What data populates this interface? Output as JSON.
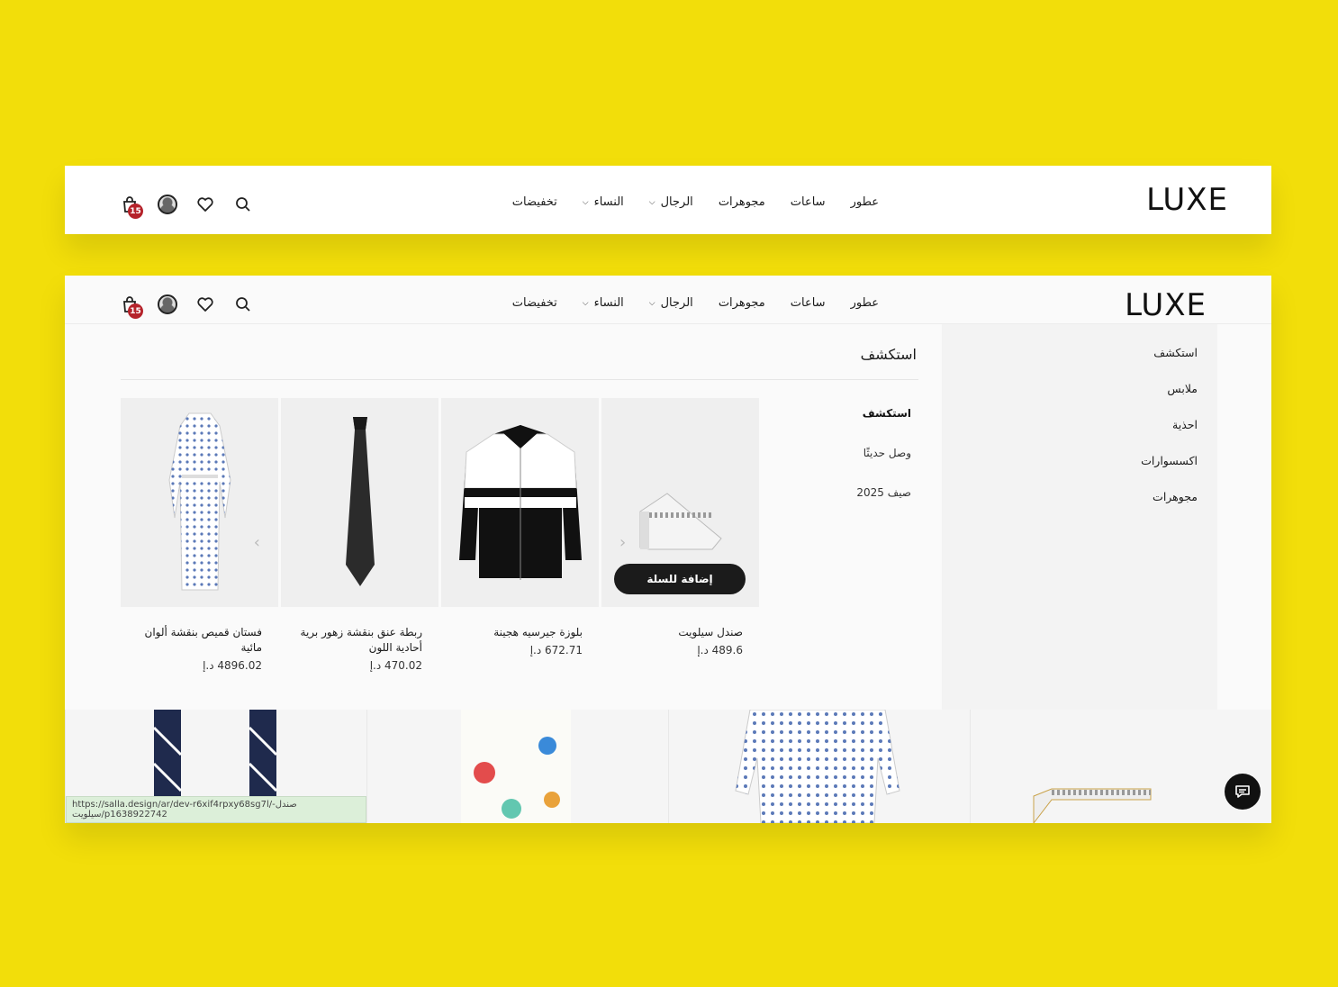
{
  "brand": {
    "logo": "LUXE"
  },
  "nav": [
    {
      "label": "تخفيضات",
      "has_dropdown": false
    },
    {
      "label": "النساء",
      "has_dropdown": true
    },
    {
      "label": "الرجال",
      "has_dropdown": true
    },
    {
      "label": "مجوهرات",
      "has_dropdown": false
    },
    {
      "label": "ساعات",
      "has_dropdown": false
    },
    {
      "label": "عطور",
      "has_dropdown": false
    }
  ],
  "header_icons": {
    "cart_count": "15",
    "icons": [
      "search-icon",
      "heart-icon",
      "avatar",
      "cart-icon"
    ]
  },
  "mega_menu": {
    "sidebar": [
      "استكشف",
      "ملابس",
      "احذية",
      "اكسسوارات",
      "مجوهرات"
    ],
    "title": "استكشف",
    "sub_links": [
      "استكشف",
      "وصل حديثًا",
      "صيف 2025"
    ],
    "products": [
      {
        "name": "فستان قميص بنقشة ألوان مائية",
        "price": "4896.02 د.إ"
      },
      {
        "name": "ربطة عنق بنقشة زهور برية أحادية اللون",
        "price": "470.02 د.إ"
      },
      {
        "name": "بلوزة جيرسيه هجينة",
        "price": "672.71 د.إ"
      },
      {
        "name": "صندل سيلويت",
        "price": "489.6 د.إ",
        "cta": "إضافة للسلة"
      }
    ]
  },
  "status_bar": {
    "url": "https://salla.design/ar/dev-r6xif4rpxy68sg7l/صندل-سيلويت/p1638922742"
  },
  "colors": {
    "background": "#f2de0a",
    "badge": "#b5222a",
    "button": "#1b1b1b"
  }
}
